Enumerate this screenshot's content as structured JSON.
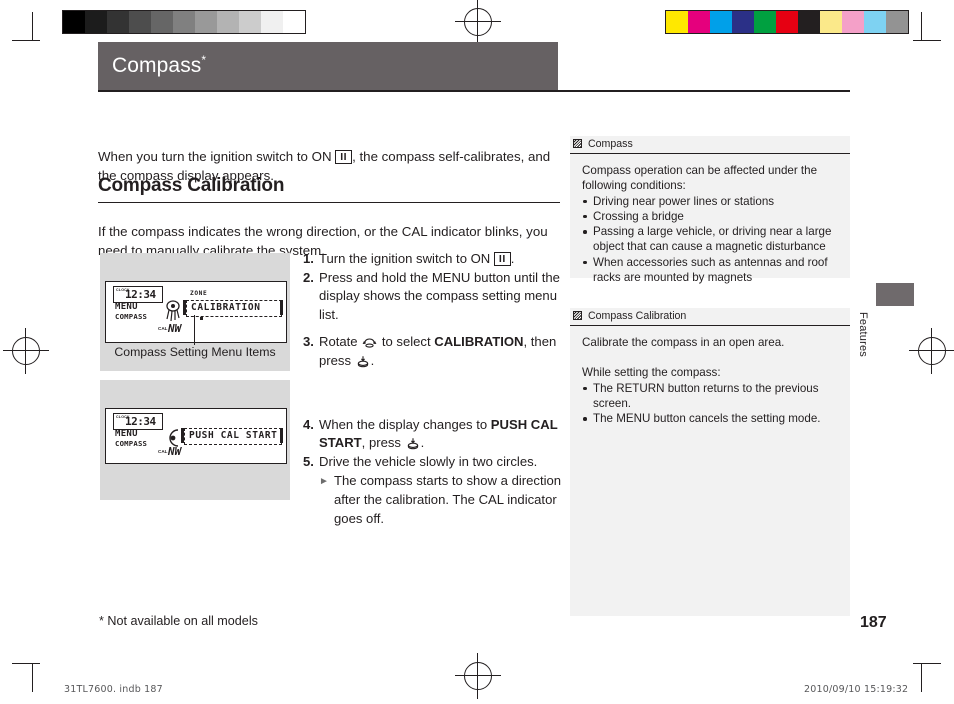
{
  "document": {
    "title": "Compass",
    "title_superscript": "*",
    "page_number": "187",
    "footnote": "* Not available on all models",
    "side_tab_label": "Features"
  },
  "print_footer": {
    "left": "31TL7600. indb   187",
    "right": "2010/09/10   15:19:32"
  },
  "intro": {
    "before_key": "When you turn the ignition switch to ON ",
    "key": "II",
    "after_key": ", the compass self-calibrates, and the compass display appears."
  },
  "section": {
    "heading": "Compass Calibration",
    "lead": "If the compass indicates the wrong direction, or the CAL indicator blinks, you need to manually calibrate the system."
  },
  "steps": [
    {
      "num": "1.",
      "before_key": "Turn the ignition switch to ON ",
      "key": "II",
      "after_key": "."
    },
    {
      "num": "2.",
      "text": "Press and hold the MENU button until the display shows the compass setting menu list."
    },
    {
      "num": "3.",
      "pre": "Rotate ",
      "icon1": "rotate-knob-icon",
      "mid": " to select ",
      "bold": "CALIBRATION",
      "post": ", then press ",
      "icon2": "press-knob-icon",
      "end": "."
    },
    {
      "num": "4.",
      "pre": "When the display changes to ",
      "bold": "PUSH CAL START",
      "post": ", press ",
      "icon2": "press-knob-icon",
      "end": "."
    },
    {
      "num": "5.",
      "text": "Drive the vehicle slowly in two circles.",
      "sub": "The compass starts to show a direction after the calibration. The CAL indicator goes off."
    }
  ],
  "figures": [
    {
      "caption": "Compass Setting Menu Items",
      "lcd": {
        "clock_label": "CLOCK",
        "time": "12:34",
        "menu": "MENU",
        "compass": "COMPASS",
        "cal_label": "CAL",
        "direction": "NW",
        "zone_label": "ZONE",
        "message": "CALIBRATION"
      }
    },
    {
      "caption": "",
      "lcd": {
        "clock_label": "CLOCK",
        "time": "12:34",
        "menu": "MENU",
        "compass": "COMPASS",
        "cal_label": "CAL",
        "direction": "NW",
        "zone_label": "",
        "message": "PUSH CAL START"
      }
    }
  ],
  "notes": [
    {
      "header": "Compass",
      "intro": "Compass operation can be affected under the following conditions:",
      "items": [
        "Driving near power lines or stations",
        "Crossing a bridge",
        "Passing a large vehicle, or driving near a large object that can cause a magnetic disturbance",
        "When accessories such as antennas and roof racks are mounted by magnets"
      ]
    },
    {
      "header": "Compass Calibration",
      "intro": "Calibrate the compass in an open area.",
      "intro2": "While setting the compass:",
      "items": [
        "The RETURN button returns to the previous screen.",
        "The MENU button cancels the setting mode."
      ]
    }
  ],
  "colors": {
    "title_bar": "#666163",
    "figure_bg": "#d9d9d9",
    "note_bg": "#f2f2f2",
    "tab": "#6f6a6c",
    "gray_steps": [
      "#000000",
      "#1c1c1c",
      "#333333",
      "#4d4d4d",
      "#666666",
      "#808080",
      "#999999",
      "#b3b3b3",
      "#cccccc",
      "#f0f0f0",
      "#ffffff"
    ],
    "color_patches": [
      "#ffe800",
      "#e5007d",
      "#00a0e9",
      "#2b3087",
      "#00a040",
      "#e60012",
      "#231f20",
      "#fbe98a",
      "#f4a0c8",
      "#7ed2f2",
      "#939393"
    ]
  }
}
